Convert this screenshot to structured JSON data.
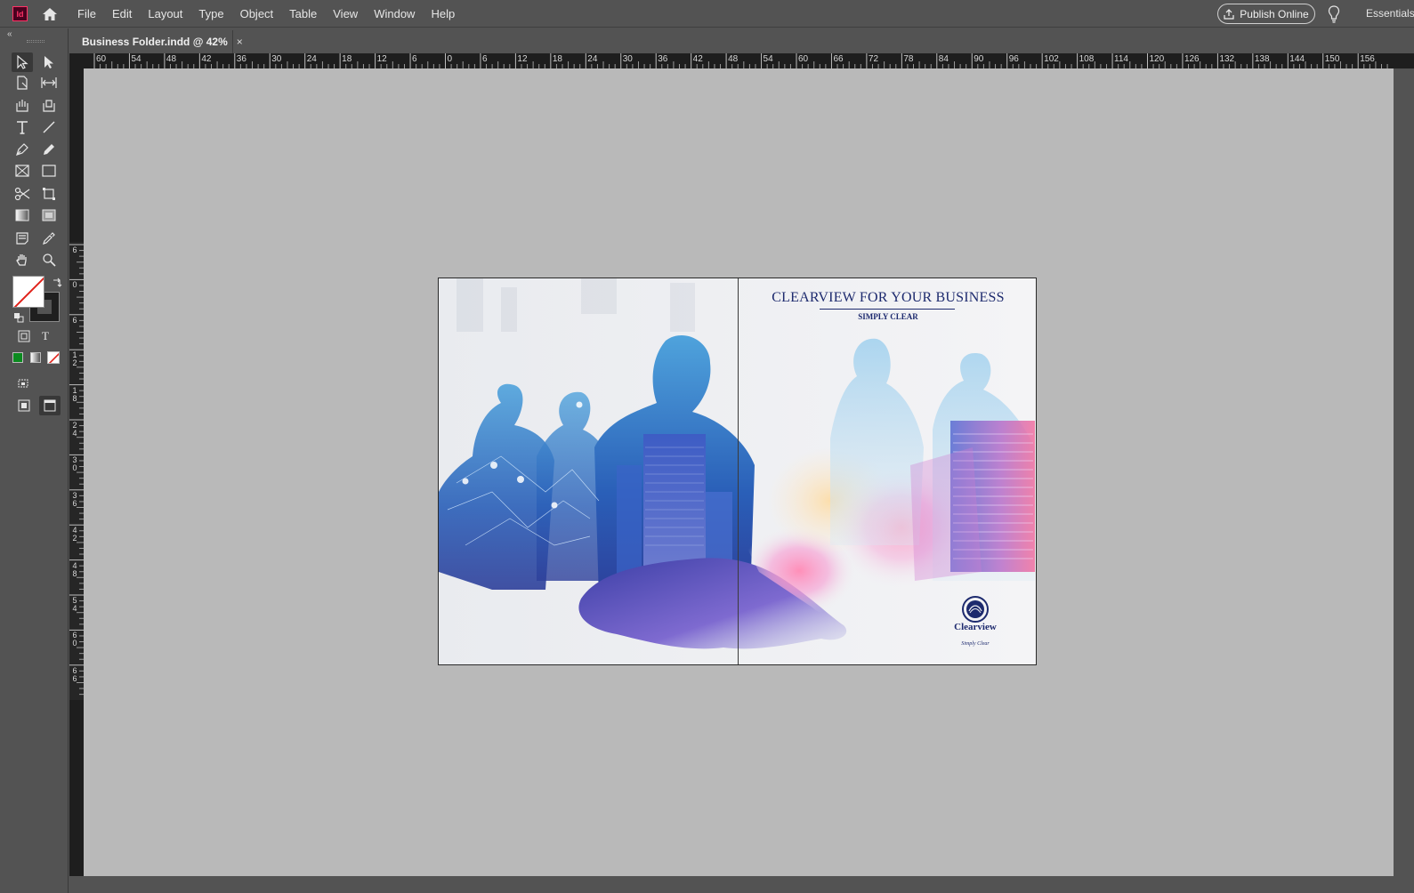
{
  "app": {
    "logo_text": "Id",
    "menu": [
      "File",
      "Edit",
      "Layout",
      "Type",
      "Object",
      "Table",
      "View",
      "Window",
      "Help"
    ],
    "publish_label": "Publish Online",
    "workspace_label": "Essentials"
  },
  "document": {
    "tab_title": "Business Folder.indd @ 42%",
    "close_glyph": "×"
  },
  "rulers": {
    "horizontal": [
      "60",
      "54",
      "48",
      "42",
      "36",
      "30",
      "24",
      "18",
      "12",
      "6",
      "0",
      "6",
      "12",
      "18",
      "24",
      "30",
      "36",
      "42",
      "48",
      "54",
      "60",
      "66",
      "72",
      "78",
      "84",
      "90",
      "96",
      "102",
      "108",
      "114",
      "120",
      "126",
      "132",
      "138",
      "144",
      "150",
      "156"
    ],
    "vertical": [
      "6",
      "0",
      "6",
      "12",
      "18",
      "24",
      "30",
      "36",
      "42",
      "48",
      "54",
      "60",
      "66"
    ]
  },
  "spread": {
    "headline": "CLEARVIEW FOR YOUR BUSINESS",
    "subheadline": "SIMPLY CLEAR",
    "brand_name": "Clearview",
    "brand_tagline": "Simply Clear"
  },
  "colors": {
    "chrome": "#535353",
    "pasteboard": "#b9b9b9",
    "ruler": "#1e1e1e",
    "headline_navy": "#1d2a6e",
    "app_accent": "#ff3366"
  }
}
